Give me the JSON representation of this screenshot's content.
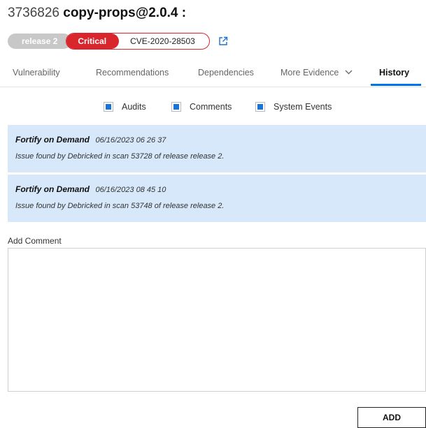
{
  "header": {
    "issue_id": "3736826",
    "package": "copy-props@2.0.4 :"
  },
  "badges": {
    "release": "release 2",
    "severity": "Critical",
    "cve": "CVE-2020-28503",
    "link_icon": "external-link-icon"
  },
  "tabs": [
    {
      "label": "Vulnerability",
      "active": false
    },
    {
      "label": "Recommendations",
      "active": false
    },
    {
      "label": "Dependencies",
      "active": false
    },
    {
      "label": "More Evidence",
      "active": false,
      "has_dropdown": true
    },
    {
      "label": "History",
      "active": true
    }
  ],
  "filters": [
    {
      "label": "Audits",
      "checked": true
    },
    {
      "label": "Comments",
      "checked": true
    },
    {
      "label": "System Events",
      "checked": true
    }
  ],
  "events": [
    {
      "source": "Fortify on Demand",
      "time": "06/16/2023 06 26 37",
      "description": "Issue found by Debricked in scan 53728 of release release 2."
    },
    {
      "source": "Fortify on Demand",
      "time": "06/16/2023 08 45 10",
      "description": "Issue found by Debricked in scan 53748 of release release 2."
    }
  ],
  "comment": {
    "label": "Add Comment",
    "value": "",
    "placeholder": ""
  },
  "actions": {
    "add_label": "ADD"
  },
  "colors": {
    "critical": "#d9262c",
    "event_bg": "#d6e8f9",
    "accent": "#0073e6",
    "checkbox": "#1a73d6"
  }
}
